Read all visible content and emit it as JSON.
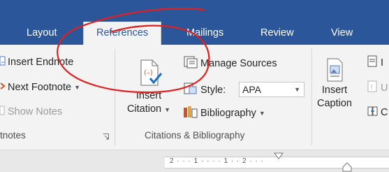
{
  "tabs": [
    {
      "label": "Layout"
    },
    {
      "label": "References"
    },
    {
      "label": "Mailings"
    },
    {
      "label": "Review"
    },
    {
      "label": "View"
    }
  ],
  "footnotes_group": {
    "insert_endnote": "Insert Endnote",
    "next_footnote": "Next Footnote",
    "show_notes": "Show Notes",
    "label": "tnotes"
  },
  "citations_group": {
    "insert_citation_line1": "Insert",
    "insert_citation_line2": "Citation",
    "manage_sources": "Manage Sources",
    "style_label": "Style:",
    "style_value": "APA",
    "bibliography": "Bibliography",
    "label": "Citations & Bibliography"
  },
  "captions_group": {
    "insert_caption_line1": "Insert",
    "insert_caption_line2": "Caption",
    "cut_off_1": "I",
    "cut_off_2": "U",
    "cut_off_3": "C"
  },
  "ruler": {
    "marks": "2 · · · 1 · · ·      · 1 · · 2 · · ·"
  },
  "colors": {
    "ribbon_blue": "#2b579a",
    "annotation_red": "#e02020",
    "citation_check": "#1e6fc7"
  }
}
